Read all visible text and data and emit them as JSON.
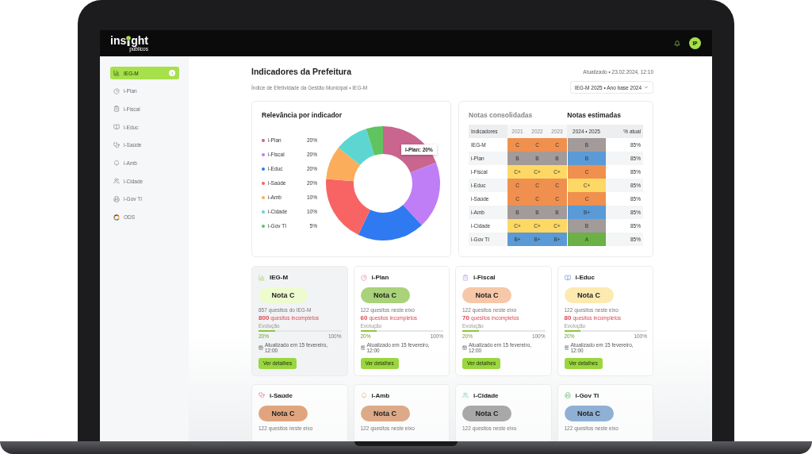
{
  "header": {
    "logo": {
      "left": "ins",
      "right": "ght",
      "tagline": "públicos"
    },
    "avatar": "IP"
  },
  "sidebar": {
    "items": [
      {
        "kind": "chart",
        "label": "IEG-M",
        "selected": true
      },
      {
        "kind": "pie",
        "label": "i-Plan",
        "selected": false
      },
      {
        "kind": "clipboard",
        "label": "i-Fiscal",
        "selected": false
      },
      {
        "kind": "book",
        "label": "i-Educ",
        "selected": false
      },
      {
        "kind": "stethoscope",
        "label": "i-Saúde",
        "selected": false
      },
      {
        "kind": "tree",
        "label": "i-Amb",
        "selected": false
      },
      {
        "kind": "people",
        "label": "i-Cidade",
        "selected": false
      },
      {
        "kind": "printer",
        "label": "i-Gov TI",
        "selected": false
      },
      {
        "kind": "ring",
        "label": "ODS",
        "selected": false
      }
    ]
  },
  "page": {
    "title": "Indicadores da Prefeitura",
    "updated": "Atualizado • 23.02.2024, 12:10",
    "subtitle": "Índice de Efetividade da Gestão Municipal • IEG-M",
    "edition": "IEG-M 2025 • Ano base 2024"
  },
  "relevance": {
    "title": "Relevância por indicador",
    "legend": [
      {
        "value": "20%",
        "color": "#c9658f"
      },
      {
        "value": "20%",
        "color": "#bf7ef5"
      },
      {
        "value": "20%",
        "color": "#2f7af0"
      },
      {
        "value": "20%",
        "color": "#f86464"
      },
      {
        "value": "10%",
        "color": "#fbad5c"
      },
      {
        "value": "10%",
        "color": "#5dd6d2"
      },
      {
        "value": "5%",
        "color": "#5fc35f"
      }
    ],
    "chart_data": {
      "type": "donut",
      "categories": [
        "i-Plan",
        "i-Fiscal",
        "i-Educ",
        "i-Saúde",
        "i-Amb",
        "i-Cidade",
        "i-Gov TI"
      ],
      "values": [
        19.05,
        19.05,
        19.05,
        19.05,
        9.52,
        9.52,
        4.76
      ],
      "annotations": [
        "i-Plan: 20%"
      ]
    }
  },
  "grades": {
    "consolidated_title": "Notas consolidadas",
    "estimated_title": "Notas estimadas",
    "columns": [
      "Indicadores",
      "2021",
      "2022",
      "2023",
      "2024 • 2025",
      "% atual"
    ],
    "rows": [
      {
        "name": "IEG-M",
        "consolidated": [
          {
            "grade": "C",
            "color": "#f0904e"
          },
          {
            "grade": "C",
            "color": "#f0904e"
          },
          {
            "grade": "C",
            "color": "#f0904e"
          }
        ],
        "estimated": {
          "grade": "B",
          "color": "#a39a9a"
        },
        "current": "85%"
      },
      {
        "name": "i-Plan",
        "consolidated": [
          {
            "grade": "B",
            "color": "#a39a9a"
          },
          {
            "grade": "B",
            "color": "#a39a9a"
          },
          {
            "grade": "B",
            "color": "#a39a9a"
          }
        ],
        "estimated": {
          "grade": "B",
          "color": "#5a9ad6"
        },
        "current": "85%"
      },
      {
        "name": "i-Fiscal",
        "consolidated": [
          {
            "grade": "C+",
            "color": "#fdd865"
          },
          {
            "grade": "C+",
            "color": "#fdd865"
          },
          {
            "grade": "C+",
            "color": "#fdd865"
          }
        ],
        "estimated": {
          "grade": "C",
          "color": "#f0904e"
        },
        "current": "85%"
      },
      {
        "name": "i-Educ",
        "consolidated": [
          {
            "grade": "C",
            "color": "#f0904e"
          },
          {
            "grade": "C",
            "color": "#f0904e"
          },
          {
            "grade": "C",
            "color": "#f0904e"
          }
        ],
        "estimated": {
          "grade": "C+",
          "color": "#fdd865"
        },
        "current": "85%"
      },
      {
        "name": "i-Saúde",
        "consolidated": [
          {
            "grade": "C",
            "color": "#f0904e"
          },
          {
            "grade": "C",
            "color": "#f0904e"
          },
          {
            "grade": "C",
            "color": "#f0904e"
          }
        ],
        "estimated": {
          "grade": "C",
          "color": "#f0904e"
        },
        "current": "85%"
      },
      {
        "name": "i-Amb",
        "consolidated": [
          {
            "grade": "B",
            "color": "#a39a9a"
          },
          {
            "grade": "B",
            "color": "#a39a9a"
          },
          {
            "grade": "B",
            "color": "#a39a9a"
          }
        ],
        "estimated": {
          "grade": "B+",
          "color": "#5a9ad6"
        },
        "current": "85%"
      },
      {
        "name": "i-Cidade",
        "consolidated": [
          {
            "grade": "C+",
            "color": "#fdd865"
          },
          {
            "grade": "C+",
            "color": "#fdd865"
          },
          {
            "grade": "C+",
            "color": "#fdd865"
          }
        ],
        "estimated": {
          "grade": "B",
          "color": "#a39a9a"
        },
        "current": "85%"
      },
      {
        "name": "i-Gov TI",
        "consolidated": [
          {
            "grade": "B+",
            "color": "#5a9ad6"
          },
          {
            "grade": "B+",
            "color": "#5a9ad6"
          },
          {
            "grade": "B+",
            "color": "#5a9ad6"
          }
        ],
        "estimated": {
          "grade": "A",
          "color": "#6cb145"
        },
        "current": "85%"
      }
    ]
  },
  "cards": [
    {
      "kind": "chart",
      "title": "IEG-M",
      "selected": true,
      "grade": {
        "label": "Nota C",
        "color": "#eefbd0"
      },
      "questions": "857 quesitos do IEG-M",
      "incomplete": {
        "count": "800",
        "label": "quesitos incompletos"
      },
      "progress": {
        "label": "Evolução",
        "level": 0.2,
        "start": "20%",
        "end": "100%"
      },
      "updated": "Atualizado em 15 fevereiro, 12:00",
      "action": "Ver detalhes"
    },
    {
      "kind": "pie",
      "title": "i-Plan",
      "selected": false,
      "grade": {
        "label": "Nota C",
        "color": "#a9d27a"
      },
      "questions": "122 quesitos neste eixo",
      "incomplete": {
        "count": "60",
        "label": "quesitos incompletos"
      },
      "progress": {
        "label": "Evolução",
        "level": 0.2,
        "start": "20%",
        "end": "100%"
      },
      "updated": "Atualizado em 15 fevereiro, 12:00",
      "action": "Ver detalhes"
    },
    {
      "kind": "clipboard",
      "title": "i-Fiscal",
      "selected": false,
      "grade": {
        "label": "Nota C",
        "color": "#f6c7a8"
      },
      "questions": "122 quesitos neste eixo",
      "incomplete": {
        "count": "70",
        "label": "quesitos incompletos"
      },
      "progress": {
        "label": "Evolução",
        "level": 0.2,
        "start": "20%",
        "end": "100%"
      },
      "updated": "Atualizado em 15 fevereiro, 12:00",
      "action": "Ver detalhes"
    },
    {
      "kind": "book",
      "title": "i-Educ",
      "selected": false,
      "grade": {
        "label": "Nota C",
        "color": "#fdeab0"
      },
      "questions": "122 quesitos neste eixo",
      "incomplete": {
        "count": "80",
        "label": "quesitos incompletos"
      },
      "progress": {
        "label": "Evolução",
        "level": 0.2,
        "start": "20%",
        "end": "100%"
      },
      "updated": "Atualizado em 15 fevereiro, 12:00",
      "action": "Ver detalhes"
    },
    {
      "kind": "stethoscope",
      "title": "i-Saúde",
      "selected": false,
      "grade": {
        "label": "Nota C",
        "color": "#e0a57e"
      },
      "questions": "122 quesitos neste eixo"
    },
    {
      "kind": "tree",
      "title": "i-Amb",
      "selected": false,
      "grade": {
        "label": "Nota C",
        "color": "#dcaa88"
      },
      "questions": "122 quesitos neste eixo"
    },
    {
      "kind": "people",
      "title": "i-Cidade",
      "selected": false,
      "grade": {
        "label": "Nota C",
        "color": "#a8a8a8"
      },
      "questions": "122 quesitos neste eixo"
    },
    {
      "kind": "printer",
      "title": "i-Gov TI",
      "selected": false,
      "grade": {
        "label": "Nota C",
        "color": "#8fb0d4"
      },
      "questions": "122 quesitos neste eixo"
    }
  ]
}
